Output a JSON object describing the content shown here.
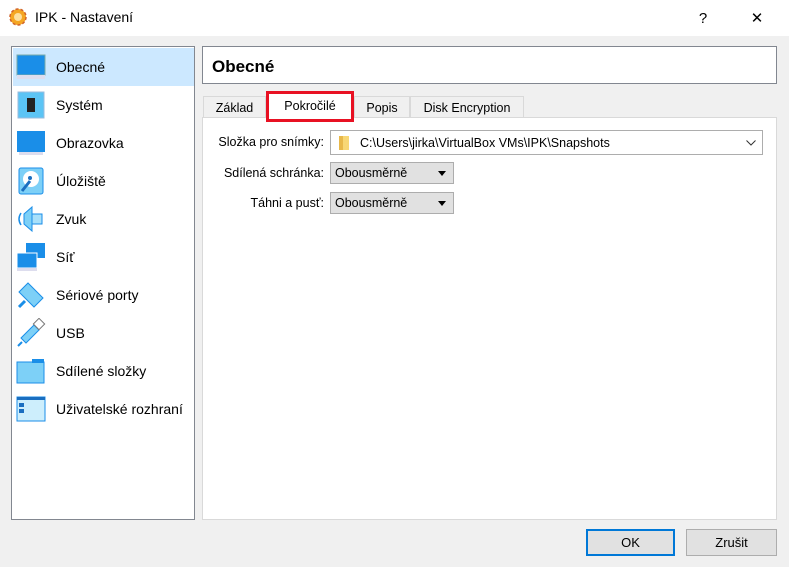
{
  "window": {
    "title": "IPK - Nastavení",
    "help": "?",
    "close": "✕"
  },
  "sidebar": {
    "items": [
      {
        "label": "Obecné",
        "icon": "general-monitor-icon",
        "selected": true
      },
      {
        "label": "Systém",
        "icon": "chip-icon"
      },
      {
        "label": "Obrazovka",
        "icon": "display-icon"
      },
      {
        "label": "Úložiště",
        "icon": "storage-disk-icon"
      },
      {
        "label": "Zvuk",
        "icon": "speaker-icon"
      },
      {
        "label": "Síť",
        "icon": "network-icon"
      },
      {
        "label": "Sériové porty",
        "icon": "serial-port-icon"
      },
      {
        "label": "USB",
        "icon": "usb-icon"
      },
      {
        "label": "Sdílené složky",
        "icon": "shared-folder-icon"
      },
      {
        "label": "Uživatelské rozhraní",
        "icon": "user-interface-icon"
      }
    ]
  },
  "header": {
    "title": "Obecné"
  },
  "tabs": [
    {
      "label": "Základ"
    },
    {
      "label": "Pokročilé",
      "active": true
    },
    {
      "label": "Popis"
    },
    {
      "label": "Disk Encryption"
    }
  ],
  "form": {
    "snapshot_label": "Složka pro snímky:",
    "snapshot_value": "C:\\Users\\jirka\\VirtualBox VMs\\IPK\\Snapshots",
    "clipboard_label": "Sdílená schránka:",
    "clipboard_value": "Obousměrně",
    "dnd_label": "Táhni a pusť:",
    "dnd_value": "Obousměrně"
  },
  "buttons": {
    "ok": "OK",
    "cancel": "Zrušit"
  },
  "colors": {
    "accent": "#0078d7",
    "selection": "#cce8ff",
    "highlight": "#e81123"
  }
}
